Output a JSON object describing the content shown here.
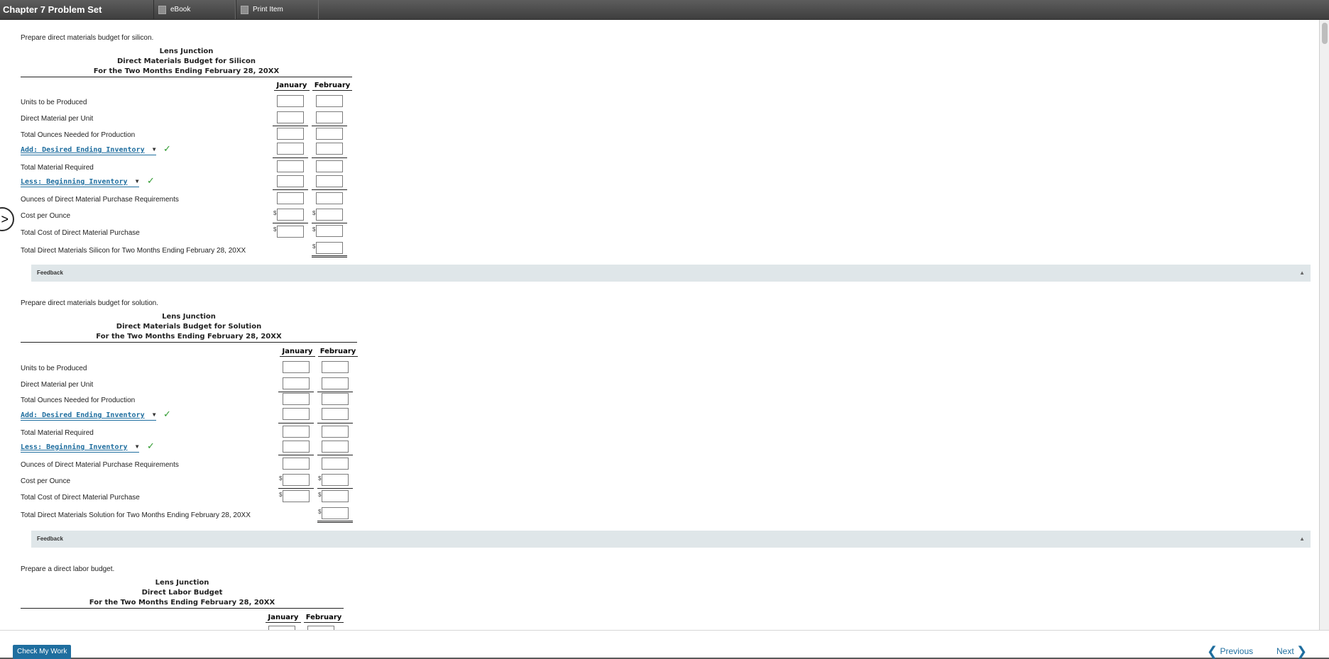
{
  "app_title": "Chapter 7 Problem Set",
  "toolbar": {
    "ebook": "eBook",
    "print": "Print Item"
  },
  "sections": [
    {
      "prompt": "Prepare direct materials budget for silicon.",
      "company": "Lens Junction",
      "title": "Direct Materials Budget for Silicon",
      "period": "For the Two Months Ending February 28, 20XX",
      "col_jan": "January",
      "col_feb": "February",
      "rows": {
        "units": "Units to be Produced",
        "dm_per_unit": "Direct Material per Unit",
        "total_ounces": "Total Ounces Needed for Production",
        "add_select": "Add: Desired Ending Inventory",
        "total_required": "Total Material Required",
        "less_select": "Less: Beginning Inventory",
        "ounces_purchase": "Ounces of Direct Material Purchase Requirements",
        "cost_per_ounce": "Cost per Ounce",
        "total_cost": "Total Cost of Direct Material Purchase",
        "grand_total": "Total Direct Materials Silicon for Two Months Ending February 28, 20XX"
      },
      "feedback": "Feedback"
    },
    {
      "prompt": "Prepare direct materials budget for solution.",
      "company": "Lens Junction",
      "title": "Direct Materials Budget for Solution",
      "period": "For the Two Months Ending February 28, 20XX",
      "col_jan": "January",
      "col_feb": "February",
      "rows": {
        "units": "Units to be Produced",
        "dm_per_unit": "Direct Material per Unit",
        "total_ounces": "Total Ounces Needed for Production",
        "add_select": "Add: Desired Ending Inventory",
        "total_required": "Total Material Required",
        "less_select": "Less: Beginning Inventory",
        "ounces_purchase": "Ounces of Direct Material Purchase Requirements",
        "cost_per_ounce": "Cost per Ounce",
        "total_cost": "Total Cost of Direct Material Purchase",
        "grand_total": "Total Direct Materials Solution for Two Months Ending February 28, 20XX"
      },
      "feedback": "Feedback"
    },
    {
      "prompt": "Prepare a direct labor budget.",
      "company": "Lens Junction",
      "title": "Direct Labor Budget",
      "period": "For the Two Months Ending February 28, 20XX",
      "col_jan": "January",
      "col_feb": "February"
    }
  ],
  "currency_symbol": "$",
  "footer": {
    "check_button": "Check My Work",
    "previous": "Previous",
    "next": "Next"
  },
  "icons": {
    "ebook": "book-icon",
    "print": "print-icon",
    "toggle": "chevron-right-icon",
    "check": "check-icon",
    "caret": "caret-down-icon",
    "feedback_caret": "caret-up-icon"
  }
}
